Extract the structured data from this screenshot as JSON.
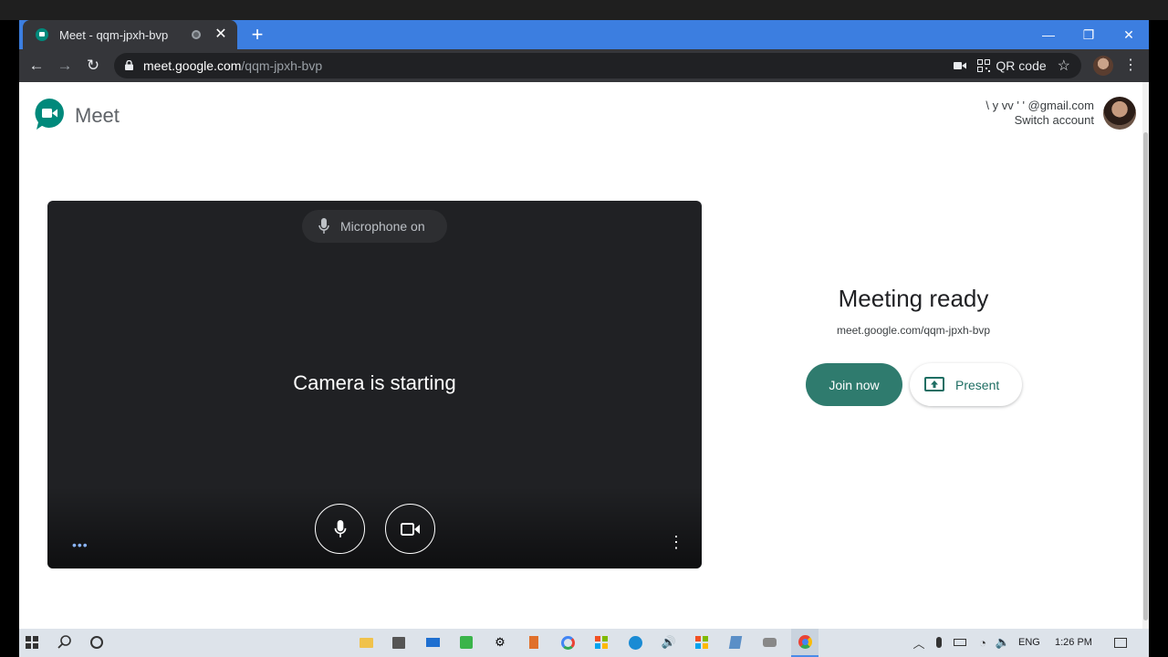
{
  "browser": {
    "tab_title": "Meet - qqm-jpxh-bvp",
    "url_host": "meet.google.com",
    "url_path": "/qqm-jpxh-bvp",
    "qr_label": "QR code"
  },
  "header": {
    "app_name": "Meet",
    "account_email": "\\ y vv  ' ' @gmail.com",
    "switch_account": "Switch account"
  },
  "preview": {
    "mic_status": "Microphone on",
    "camera_message": "Camera is starting"
  },
  "join_panel": {
    "title": "Meeting ready",
    "meeting_url": "meet.google.com/qqm-jpxh-bvp",
    "join_label": "Join now",
    "present_label": "Present"
  },
  "taskbar": {
    "language": "ENG",
    "time": "1:26 PM"
  },
  "colors": {
    "chrome_tab_strip": "#3c7ee0",
    "chrome_toolbar": "#35363a",
    "join_button": "#2f7b6e",
    "video_bg": "#202124"
  },
  "icons": [
    "lock-icon",
    "camera-off-icon",
    "qr-code-icon",
    "star-icon",
    "microphone-icon",
    "video-camera-icon",
    "present-screen-icon",
    "windows-start-icon",
    "search-icon",
    "cortana-icon"
  ]
}
